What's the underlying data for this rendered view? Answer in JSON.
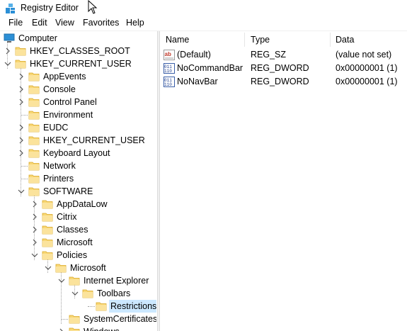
{
  "window": {
    "title": "Registry Editor"
  },
  "menu": [
    "File",
    "Edit",
    "View",
    "Favorites",
    "Help"
  ],
  "tree": {
    "root": "Computer",
    "nodes": [
      {
        "label": "HKEY_CLASSES_ROOT",
        "level": 1,
        "expander": "collapsed"
      },
      {
        "label": "HKEY_CURRENT_USER",
        "level": 1,
        "expander": "expanded"
      },
      {
        "label": "AppEvents",
        "level": 2,
        "expander": "collapsed"
      },
      {
        "label": "Console",
        "level": 2,
        "expander": "collapsed"
      },
      {
        "label": "Control Panel",
        "level": 2,
        "expander": "collapsed"
      },
      {
        "label": "Environment",
        "level": 2,
        "expander": "none"
      },
      {
        "label": "EUDC",
        "level": 2,
        "expander": "collapsed"
      },
      {
        "label": "HKEY_CURRENT_USER",
        "level": 2,
        "expander": "collapsed"
      },
      {
        "label": "Keyboard Layout",
        "level": 2,
        "expander": "collapsed"
      },
      {
        "label": "Network",
        "level": 2,
        "expander": "none"
      },
      {
        "label": "Printers",
        "level": 2,
        "expander": "none"
      },
      {
        "label": "SOFTWARE",
        "level": 2,
        "expander": "expanded"
      },
      {
        "label": "AppDataLow",
        "level": 3,
        "expander": "collapsed"
      },
      {
        "label": "Citrix",
        "level": 3,
        "expander": "collapsed"
      },
      {
        "label": "Classes",
        "level": 3,
        "expander": "collapsed"
      },
      {
        "label": "Microsoft",
        "level": 3,
        "expander": "collapsed"
      },
      {
        "label": "Policies",
        "level": 3,
        "expander": "expanded"
      },
      {
        "label": "Microsoft",
        "level": 4,
        "expander": "expanded"
      },
      {
        "label": "Internet Explorer",
        "level": 5,
        "expander": "expanded"
      },
      {
        "label": "Toolbars",
        "level": 6,
        "expander": "expanded"
      },
      {
        "label": "Restrictions",
        "level": 7,
        "expander": "none",
        "selected": true
      },
      {
        "label": "SystemCertificates",
        "level": 5,
        "expander": "none"
      },
      {
        "label": "Windows",
        "level": 5,
        "expander": "collapsed"
      }
    ]
  },
  "values_table": {
    "columns": [
      "Name",
      "Type",
      "Data"
    ],
    "rows": [
      {
        "icon": "string-value-icon",
        "name": "(Default)",
        "type": "REG_SZ",
        "data": "(value not set)"
      },
      {
        "icon": "dword-value-icon",
        "name": "NoCommandBar",
        "type": "REG_DWORD",
        "data": "0x00000001 (1)"
      },
      {
        "icon": "dword-value-icon",
        "name": "NoNavBar",
        "type": "REG_DWORD",
        "data": "0x00000001 (1)"
      }
    ]
  },
  "colors": {
    "selection": "#cce8ff",
    "folder": "#f8d775",
    "computer_icon": "#2b8fd6"
  }
}
